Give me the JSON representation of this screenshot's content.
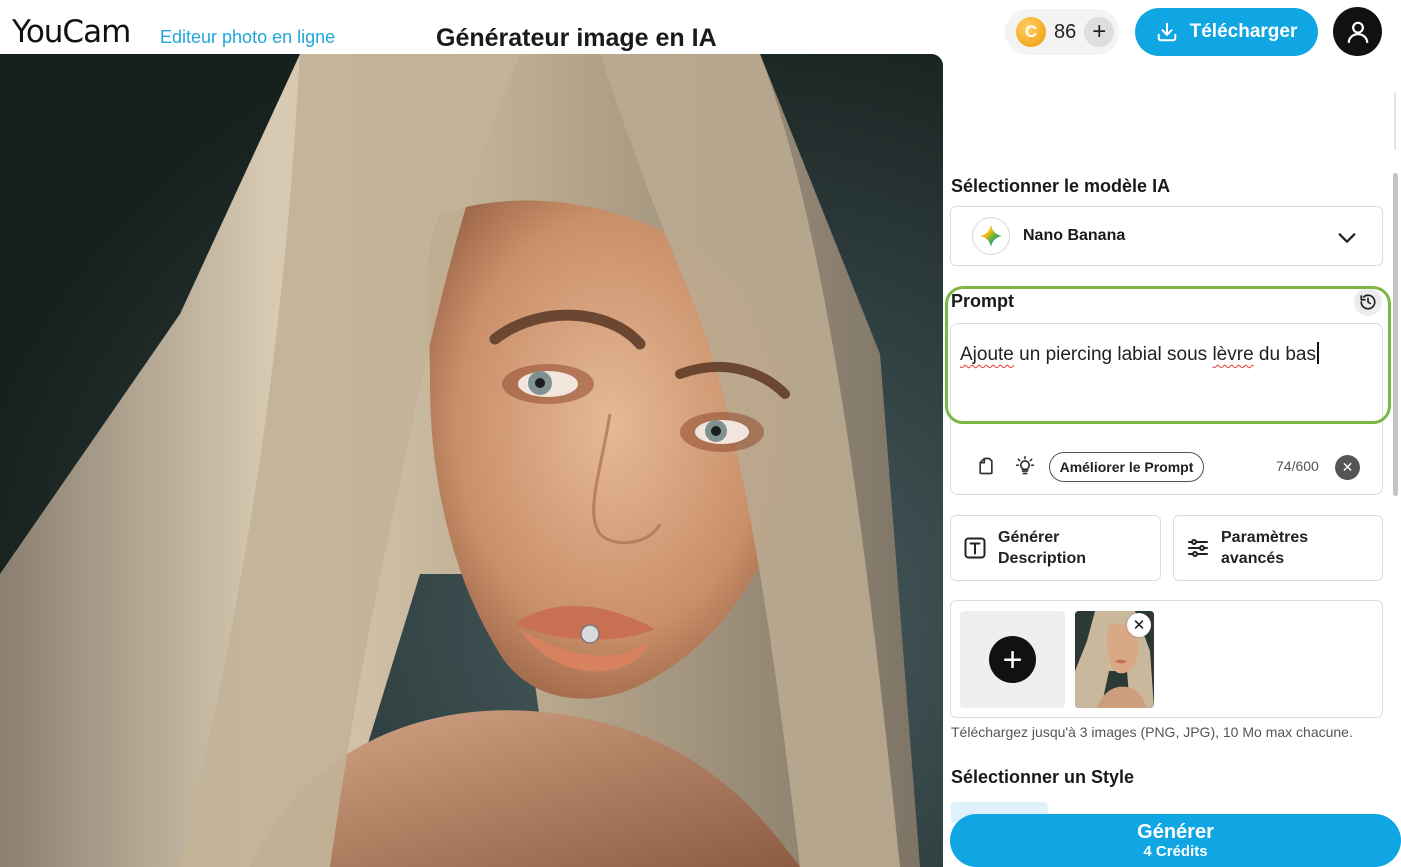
{
  "header": {
    "logo": "YouCam",
    "logo_subtitle": "Editeur photo en ligne",
    "page_title": "Générateur image en IA",
    "credits": "86",
    "coin_symbol": "C",
    "add_credits_symbol": "+",
    "download_label": "Télécharger",
    "account_icon": "user-icon"
  },
  "panel": {
    "model_section_label": "Sélectionner le modèle IA",
    "selected_model": "Nano Banana",
    "prompt_label": "Prompt",
    "prompt_text_word1": "Ajoute",
    "prompt_text_middle": " un piercing labial sous ",
    "prompt_text_word2": "lèvre",
    "prompt_text_end": " du bas",
    "enhance_prompt_label": "Améliorer le Prompt",
    "char_count": "74/600",
    "clear_symbol": "✕",
    "generate_description_label": "Générer Description",
    "advanced_settings_label": "Paramètres avancés",
    "upload_add_symbol": "+",
    "thumb_remove_symbol": "✕",
    "upload_hint": "Téléchargez jusqu'à 3 images (PNG, JPG), 10 Mo max chacune.",
    "style_section_label": "Sélectionner un Style"
  },
  "generate": {
    "label": "Générer",
    "cost": "4 Crédits"
  },
  "colors": {
    "accent": "#10a5e3",
    "focus_ring": "#79b843",
    "logo_subtitle": "#21a6d9"
  }
}
